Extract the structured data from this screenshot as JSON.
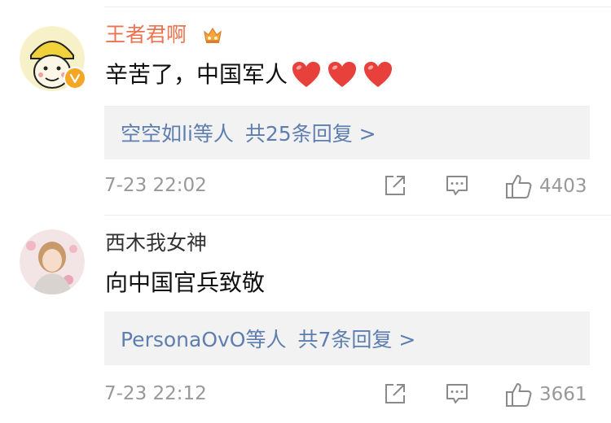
{
  "comments": [
    {
      "username": "王者君啊",
      "content": "辛苦了，中国军人",
      "hearts": 3,
      "reply_users": "空空如li等人",
      "reply_count": "共25条回复 >",
      "timestamp": "7-23 22:02",
      "likes": "4403"
    },
    {
      "username": "西木我女神",
      "content": "向中国官兵致敬",
      "reply_users": "PersonaOvO等人",
      "reply_count": "共7条回复 >",
      "timestamp": "7-23 22:12",
      "likes": "3661"
    }
  ],
  "colors": {
    "vip_name": "#eb7350",
    "link": "#5d7eaf",
    "meta": "#999999",
    "heart": "#e8403a"
  },
  "icons": {
    "share": "share-icon",
    "comment": "comment-icon",
    "like": "thumbs-up-icon",
    "heart": "heart-icon",
    "vip": "crown-badge-icon",
    "verified": "verified-badge-icon"
  }
}
